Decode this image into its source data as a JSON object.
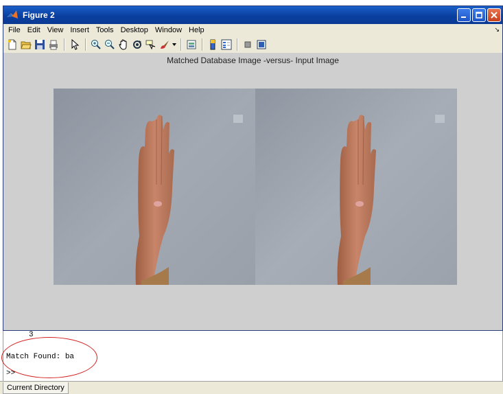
{
  "window": {
    "title": "Figure 2",
    "controls": [
      "minimize-icon",
      "maximize-icon",
      "close-icon"
    ]
  },
  "menu": {
    "items": [
      "File",
      "Edit",
      "View",
      "Insert",
      "Tools",
      "Desktop",
      "Window",
      "Help"
    ],
    "dock_glyph": "↘"
  },
  "toolbar": {
    "icons": [
      "new-figure-icon",
      "open-file-icon",
      "save-icon",
      "print-icon",
      "pointer-icon",
      "zoom-in-icon",
      "zoom-out-icon",
      "pan-icon",
      "rotate-3d-icon",
      "data-cursor-icon",
      "brush-icon",
      "link-plot-icon",
      "colorbar-icon",
      "legend-icon",
      "hide-plot-tools-icon",
      "show-plot-tools-icon"
    ]
  },
  "figure": {
    "title": "Matched Database Image -versus- Input Image",
    "panels": [
      "matched-database-image",
      "input-image"
    ]
  },
  "command_window": {
    "lines": [
      "     3",
      "",
      "Match Found: ba",
      ">>"
    ],
    "highlight_color": "#d42020"
  },
  "status": {
    "tab": "Current Directory"
  },
  "colors": {
    "titlebar": "#0a3fa0",
    "figure_bg": "#cfcfcf",
    "wall": "#9aa1ac",
    "skin": "#c07a5c"
  }
}
